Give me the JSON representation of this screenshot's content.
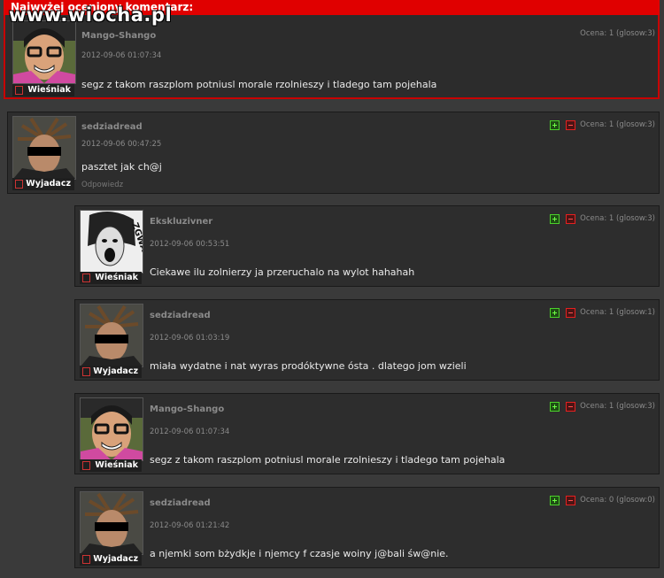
{
  "site": {
    "watermark": "www.wiocha.pl"
  },
  "top": {
    "header": "Najwyżej oceniony komentarz:",
    "comment": {
      "user": "Mango-Shango",
      "date": "2012-09-06 01:07:34",
      "text": "segz z takom raszplom potniusl morale rzolnieszy i tladego tam pojehala",
      "score": "Ocena: 1 (glosow:3)",
      "rank": "Wieśniak",
      "avatar_icon": "austin-powers-avatar-icon"
    }
  },
  "thread": {
    "parent": {
      "user": "sedziadread",
      "date": "2012-09-06 00:47:25",
      "text": "pasztet jak ch@j",
      "score": "Ocena: 1 (glosow:3)",
      "rank": "Wyjadacz",
      "reply_label": "Odpowiedz",
      "avatar_icon": "censored-face-avatar-icon"
    },
    "replies": [
      {
        "user": "Ekskluzivner",
        "date": "2012-09-06 00:53:51",
        "text": "Ciekawe ilu zolnierzy ja przeruchalo na wylot hahahah",
        "score": "Ocena: 1 (glosow:3)",
        "rank": "Wieśniak",
        "avatar_icon": "screaming-woman-avatar-icon"
      },
      {
        "user": "sedziadread",
        "date": "2012-09-06 01:03:19",
        "text": "miała wydatne i nat wyras prodóktywne ósta . dlatego jom wzieli",
        "score": "Ocena: 1 (glosow:1)",
        "rank": "Wyjadacz",
        "avatar_icon": "censored-face-avatar-icon"
      },
      {
        "user": "Mango-Shango",
        "date": "2012-09-06 01:07:34",
        "text": "segz z takom raszplom potniusl morale rzolnieszy i tladego tam pojehala",
        "score": "Ocena: 1 (glosow:3)",
        "rank": "Wieśniak",
        "avatar_icon": "austin-powers-avatar-icon"
      },
      {
        "user": "sedziadread",
        "date": "2012-09-06 01:21:42",
        "text": "a njemki som bżydkje i njemcy f czasje woiny j@bali św@nie.",
        "score": "Ocena: 0 (glosow:0)",
        "rank": "Wyjadacz",
        "avatar_icon": "censored-face-avatar-icon"
      }
    ]
  },
  "colors": {
    "background": "#3a3a3a",
    "header_red": "#e00000",
    "vote_up": "#4bd12a",
    "vote_down": "#e52020"
  }
}
